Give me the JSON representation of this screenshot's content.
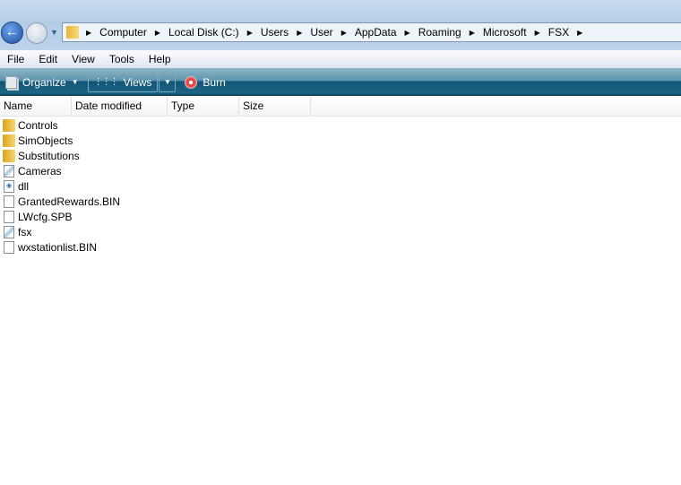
{
  "nav": {
    "back_icon": "back-arrow-icon",
    "forward_icon": "forward-arrow-icon"
  },
  "address": {
    "crumbs": [
      "Computer",
      "Local Disk (C:)",
      "Users",
      "User",
      "AppData",
      "Roaming",
      "Microsoft",
      "FSX"
    ]
  },
  "menu": [
    "File",
    "Edit",
    "View",
    "Tools",
    "Help"
  ],
  "toolbar": {
    "organize": "Organize",
    "views": "Views",
    "burn": "Burn"
  },
  "columns": [
    "Name",
    "Date modified",
    "Type",
    "Size"
  ],
  "files": [
    {
      "name": "Controls",
      "icon": "folder"
    },
    {
      "name": "SimObjects",
      "icon": "folder"
    },
    {
      "name": "Substitutions",
      "icon": "folder"
    },
    {
      "name": "Cameras",
      "icon": "cfg"
    },
    {
      "name": "dll",
      "icon": "dll"
    },
    {
      "name": "GrantedRewards.BIN",
      "icon": "file"
    },
    {
      "name": "LWcfg.SPB",
      "icon": "file"
    },
    {
      "name": "fsx",
      "icon": "cfg"
    },
    {
      "name": "wxstationlist.BIN",
      "icon": "file"
    }
  ]
}
